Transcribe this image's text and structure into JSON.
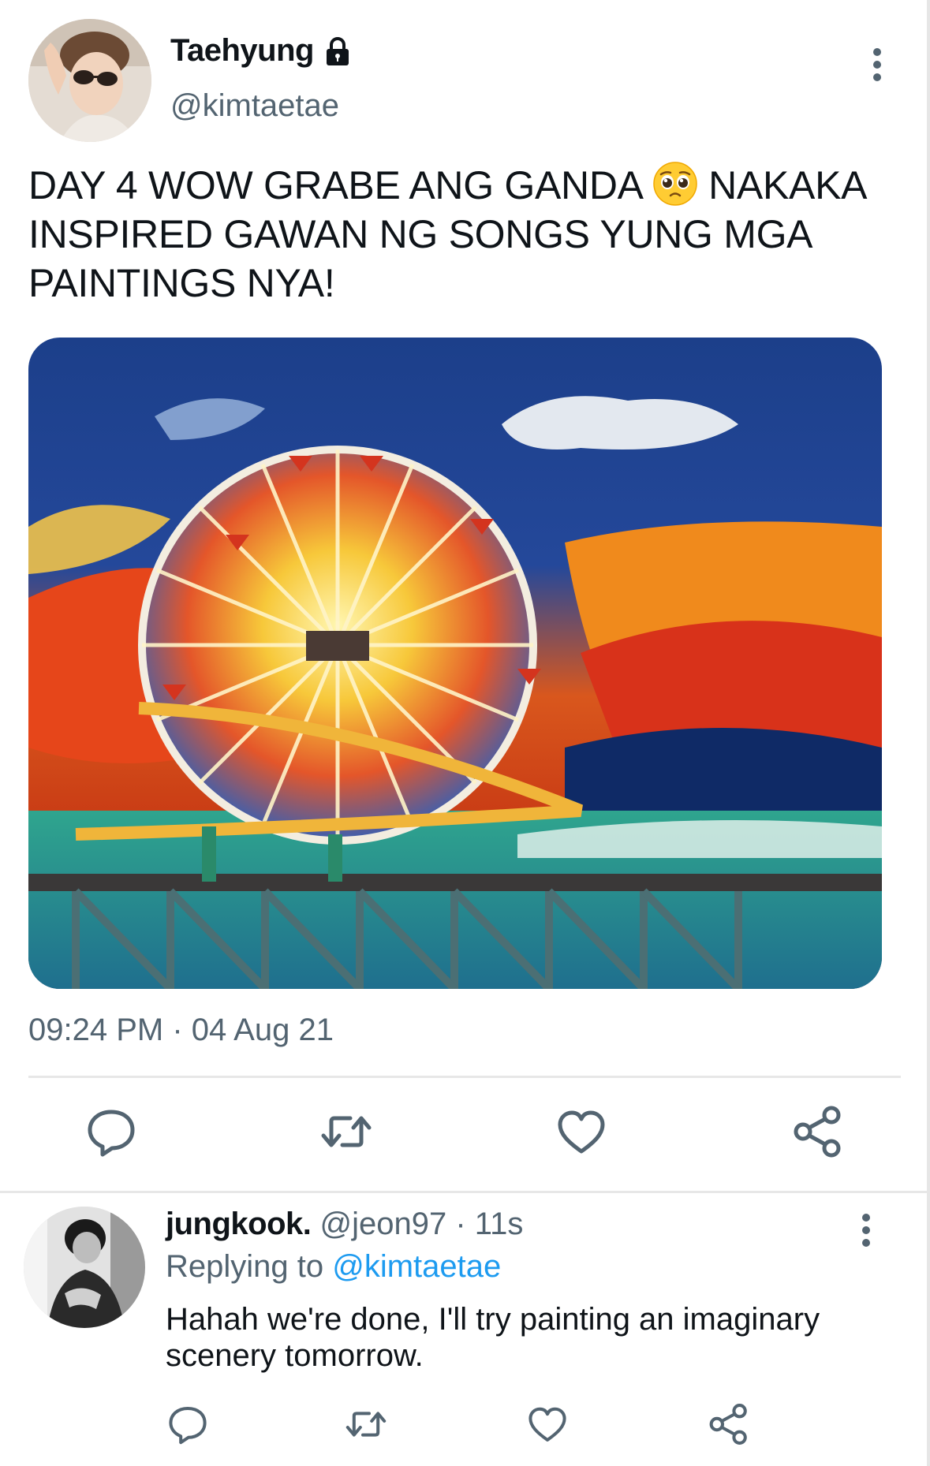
{
  "tweet": {
    "display_name": "Taehyung",
    "handle": "@kimtaetae",
    "text_before_emoji": "DAY 4 WOW GRABE ANG GANDA ",
    "emoji": "pleading-face-emoji",
    "text_after_emoji": " NAKAKA INSPIRED GAWAN NG SONGS YUNG MGA PAINTINGS NYA!",
    "timestamp": "09:24 PM · 04 Aug 21",
    "media_subject": "ferris-wheel-painting",
    "actions": [
      "reply-icon",
      "retweet-icon",
      "like-icon",
      "share-icon"
    ],
    "protected_icon": "lock-icon"
  },
  "reply": {
    "display_name": "jungkook.",
    "handle": "@jeon97",
    "separator": " · ",
    "time": "11s",
    "replying_prefix": "Replying to ",
    "replying_handle": "@kimtaetae",
    "text": "Hahah we're done, I'll try painting an imaginary scenery tomorrow.",
    "actions": [
      "reply-icon",
      "retweet-icon",
      "like-icon",
      "share-icon"
    ]
  },
  "colors": {
    "text_primary": "#0f1419",
    "text_secondary": "#536471",
    "link": "#1d9bf0",
    "divider": "#e7e7e7"
  }
}
